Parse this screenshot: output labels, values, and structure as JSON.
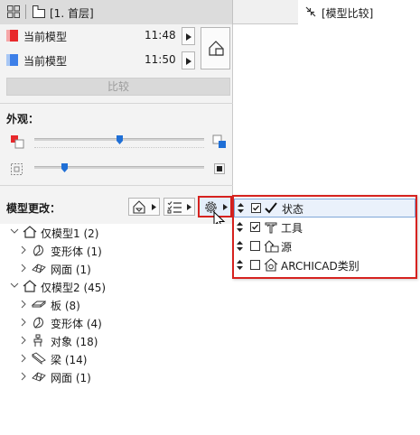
{
  "tabs": {
    "floor_plan_label": "[1. 首层]",
    "compare_label": "[模型比较]"
  },
  "models": [
    {
      "label": "当前模型",
      "time": "11:48",
      "color": "#e8282b"
    },
    {
      "label": "当前模型",
      "time": "11:50",
      "color": "#3d7fe8"
    }
  ],
  "compare_button_label": "比较",
  "appearance": {
    "title": "外观：",
    "sliders": [
      {
        "name": "color-blend",
        "value": 0.5
      },
      {
        "name": "opacity",
        "value": 0.18
      }
    ]
  },
  "changes": {
    "title": "模型更改："
  },
  "tree": [
    {
      "label": "仅模型1 (2)",
      "expanded": true,
      "children": [
        {
          "label": "变形体 (1)",
          "icon": "morph-icon"
        },
        {
          "label": "网面 (1)",
          "icon": "mesh-icon"
        }
      ]
    },
    {
      "label": "仅模型2 (45)",
      "expanded": true,
      "children": [
        {
          "label": "板 (8)",
          "icon": "slab-icon"
        },
        {
          "label": "变形体 (4)",
          "icon": "morph-icon"
        },
        {
          "label": "对象 (18)",
          "icon": "object-icon"
        },
        {
          "label": "梁 (14)",
          "icon": "beam-icon"
        },
        {
          "label": "网面 (1)",
          "icon": "mesh-icon"
        }
      ]
    }
  ],
  "popup_menu": {
    "items": [
      {
        "label": "状态",
        "checked": true,
        "icon": "checkmark-icon"
      },
      {
        "label": "工具",
        "checked": true,
        "icon": "tool-icon"
      },
      {
        "label": "源",
        "checked": false,
        "icon": "source-icon"
      },
      {
        "label": "ARCHICAD类别",
        "checked": false,
        "icon": "classification-icon"
      }
    ]
  },
  "colors": {
    "highlight_border": "#d6221f",
    "model1": "#e8282b",
    "model2": "#3d7fe8",
    "slider_thumb": "#1f6fd6"
  }
}
